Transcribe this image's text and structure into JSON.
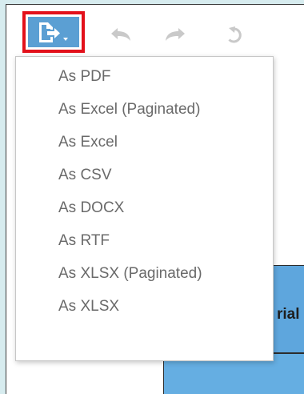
{
  "toolbar": {
    "export_button_icon": "export-document-icon",
    "undo_icon": "undo-arrow-icon",
    "redo_icon": "redo-arrow-icon",
    "revert_icon": "revert-icon",
    "accent_color": "#5b9fd3",
    "highlight_color": "#e3111b"
  },
  "export_menu": {
    "items": [
      {
        "label": "As PDF"
      },
      {
        "label": "As Excel (Paginated)"
      },
      {
        "label": "As Excel"
      },
      {
        "label": "As CSV"
      },
      {
        "label": "As DOCX"
      },
      {
        "label": "As RTF"
      },
      {
        "label": "As XLSX (Paginated)"
      },
      {
        "label": "As XLSX"
      }
    ]
  },
  "report": {
    "partial_text": "rial"
  }
}
